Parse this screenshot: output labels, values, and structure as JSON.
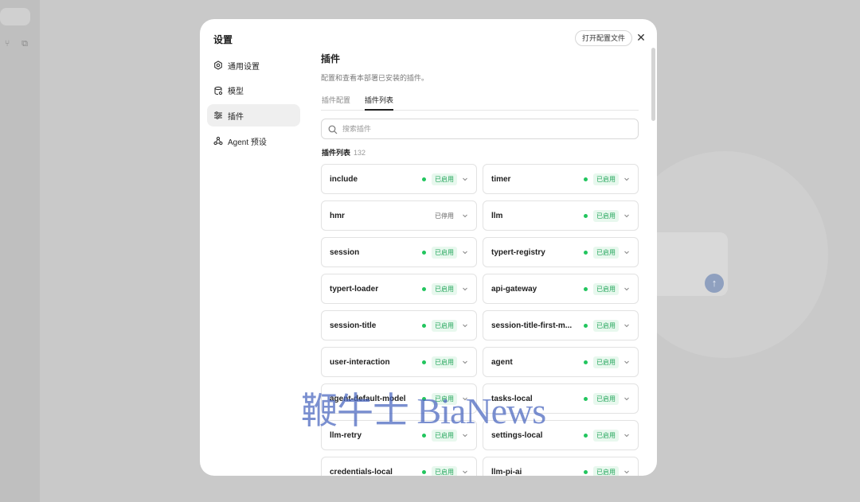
{
  "modal": {
    "title": "设置",
    "open_config_label": "打开配置文件",
    "close_icon": "close-icon"
  },
  "nav": [
    {
      "label": "通用设置",
      "icon": "gear-icon",
      "active": false
    },
    {
      "label": "模型",
      "icon": "database-icon",
      "active": false
    },
    {
      "label": "插件",
      "icon": "sliders-icon",
      "active": true
    },
    {
      "label": "Agent 预设",
      "icon": "agent-icon",
      "active": false
    }
  ],
  "section": {
    "title": "插件",
    "description": "配置和查看本部署已安装的插件。"
  },
  "tabs": [
    {
      "label": "插件配置",
      "active": false
    },
    {
      "label": "插件列表",
      "active": true
    }
  ],
  "search": {
    "placeholder": "搜索插件",
    "value": ""
  },
  "list": {
    "heading": "插件列表",
    "count": "132",
    "plugins": [
      {
        "name": "include",
        "status": "已启用",
        "enabled": true
      },
      {
        "name": "timer",
        "status": "已启用",
        "enabled": true
      },
      {
        "name": "hmr",
        "status": "已停用",
        "enabled": false
      },
      {
        "name": "llm",
        "status": "已启用",
        "enabled": true
      },
      {
        "name": "session",
        "status": "已启用",
        "enabled": true
      },
      {
        "name": "typert-registry",
        "status": "已启用",
        "enabled": true
      },
      {
        "name": "typert-loader",
        "status": "已启用",
        "enabled": true
      },
      {
        "name": "api-gateway",
        "status": "已启用",
        "enabled": true
      },
      {
        "name": "session-title",
        "status": "已启用",
        "enabled": true
      },
      {
        "name": "session-title-first-m...",
        "status": "已启用",
        "enabled": true
      },
      {
        "name": "user-interaction",
        "status": "已启用",
        "enabled": true
      },
      {
        "name": "agent",
        "status": "已启用",
        "enabled": true
      },
      {
        "name": "agent-default-model",
        "status": "已启用",
        "enabled": true
      },
      {
        "name": "tasks-local",
        "status": "已启用",
        "enabled": true
      },
      {
        "name": "llm-retry",
        "status": "已启用",
        "enabled": true
      },
      {
        "name": "settings-local",
        "status": "已启用",
        "enabled": true
      },
      {
        "name": "credentials-local",
        "status": "已启用",
        "enabled": true
      },
      {
        "name": "llm-pi-ai",
        "status": "已启用",
        "enabled": true
      }
    ]
  },
  "watermark": "鞭牛士 BiaNews",
  "colors": {
    "enabled_dot": "#22c55e",
    "enabled_badge_bg": "#e8f8ee",
    "enabled_badge_text": "#22a55a"
  }
}
